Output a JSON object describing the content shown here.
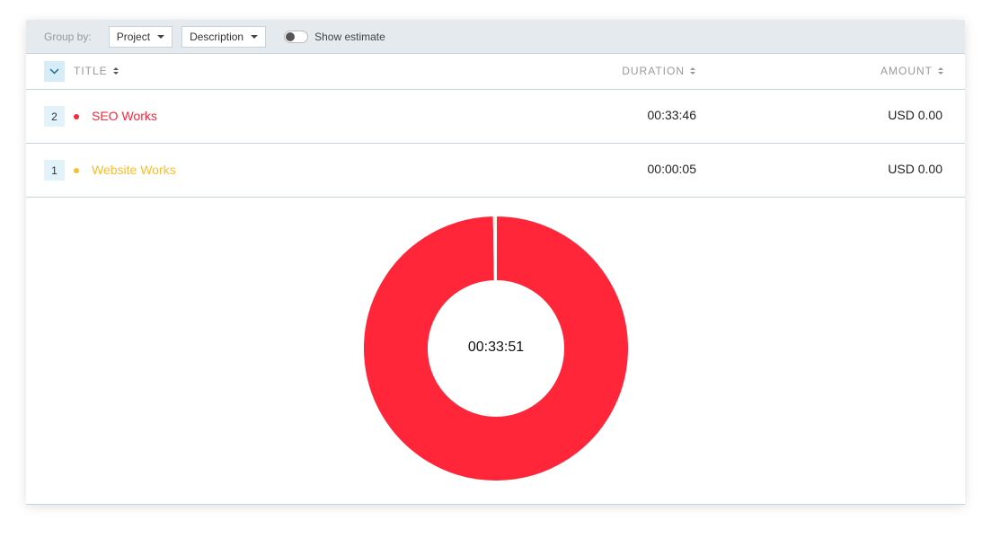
{
  "toolbar": {
    "group_by_label": "Group by:",
    "group_primary": "Project",
    "group_secondary": "Description",
    "show_estimate_label": "Show estimate",
    "show_estimate_on": false
  },
  "table": {
    "headers": {
      "title": "TITLE",
      "duration": "DURATION",
      "amount": "AMOUNT"
    },
    "rows": [
      {
        "count": "2",
        "title": "SEO Works",
        "color": "#ff2639",
        "duration": "00:33:46",
        "amount": "USD 0.00"
      },
      {
        "count": "1",
        "title": "Website Works",
        "color": "#fcbc30",
        "duration": "00:00:05",
        "amount": "USD 0.00"
      }
    ]
  },
  "chart_data": {
    "type": "pie",
    "center_label": "00:33:51",
    "categories": [
      "SEO Works",
      "Website Works"
    ],
    "values": [
      2026,
      5
    ],
    "colors": [
      "#ff2639",
      "#fcbc30"
    ]
  }
}
